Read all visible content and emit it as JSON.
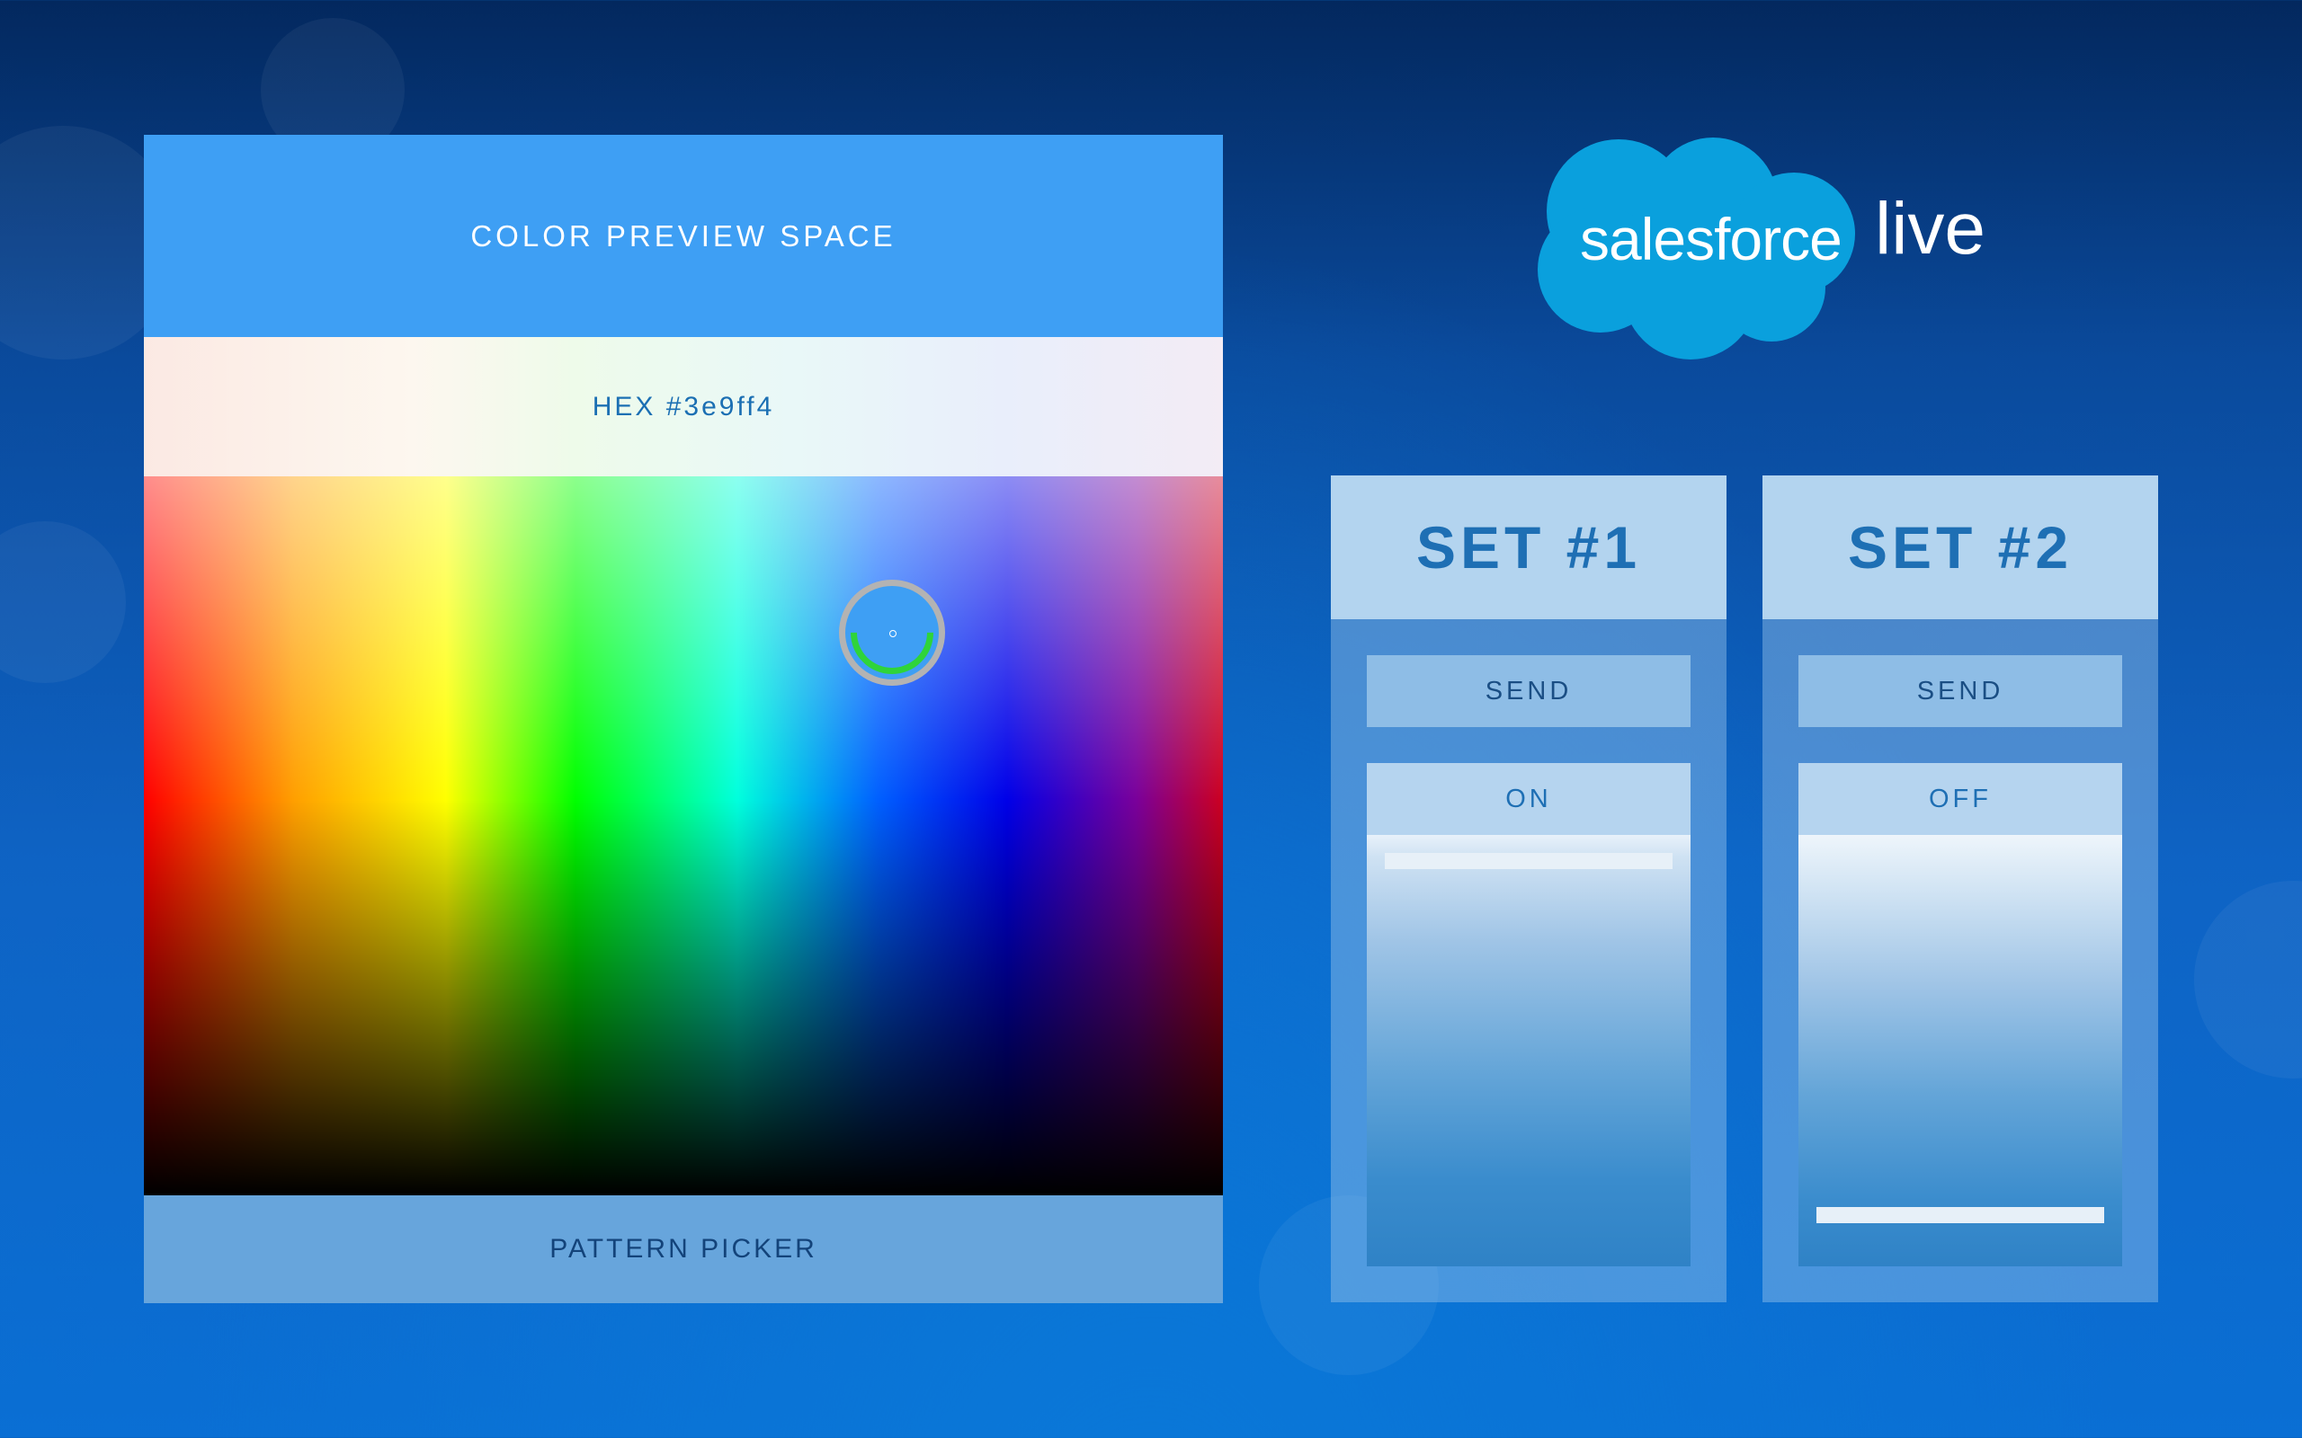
{
  "color_picker": {
    "preview_label": "COLOR PREVIEW SPACE",
    "hex_label": "HEX #3e9ff4",
    "selected_color": "#3e9ff4",
    "pattern_picker_label": "PATTERN PICKER"
  },
  "logo": {
    "brand": "salesforce",
    "suffix": "live",
    "cloud_color": "#0aa0dd"
  },
  "sets": [
    {
      "title": "SET #1",
      "send_label": "SEND",
      "state": "ON"
    },
    {
      "title": "SET #2",
      "send_label": "SEND",
      "state": "OFF"
    }
  ]
}
